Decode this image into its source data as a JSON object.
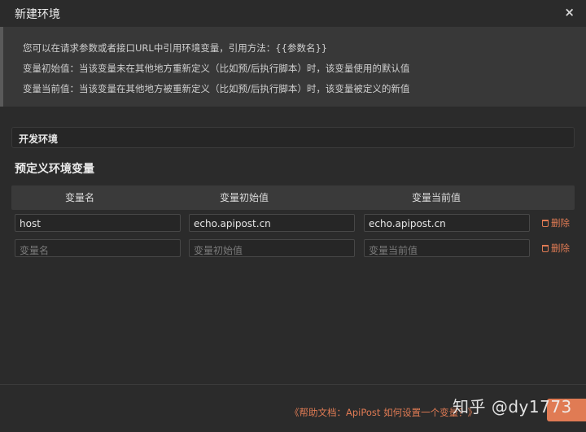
{
  "dialog": {
    "title": "新建环境",
    "close_label": "×"
  },
  "info": {
    "line1": "您可以在请求参数或者接口URL中引用环境变量，引用方法：{{参数名}}",
    "line2": "变量初始值：当该变量未在其他地方重新定义（比如预/后执行脚本）时，该变量使用的默认值",
    "line3": "变量当前值：当该变量在其他地方被重新定义（比如预/后执行脚本）时，该变量被定义的新值"
  },
  "env_name": "开发环境",
  "section_title": "预定义环境变量",
  "table": {
    "headers": [
      "变量名",
      "变量初始值",
      "变量当前值"
    ],
    "rows": [
      {
        "name": "host",
        "initial": "echo.apipost.cn",
        "current": "echo.apipost.cn",
        "delete": "删除"
      }
    ],
    "empty_row": {
      "name_placeholder": "变量名",
      "initial_placeholder": "变量初始值",
      "current_placeholder": "变量当前值",
      "delete": "删除"
    }
  },
  "footer": {
    "help_link": "《帮助文档：ApiPost 如何设置一个变量？》"
  },
  "watermark": "知乎 @dy1773",
  "colors": {
    "accent": "#e07b54",
    "background": "#2b2b2b"
  }
}
